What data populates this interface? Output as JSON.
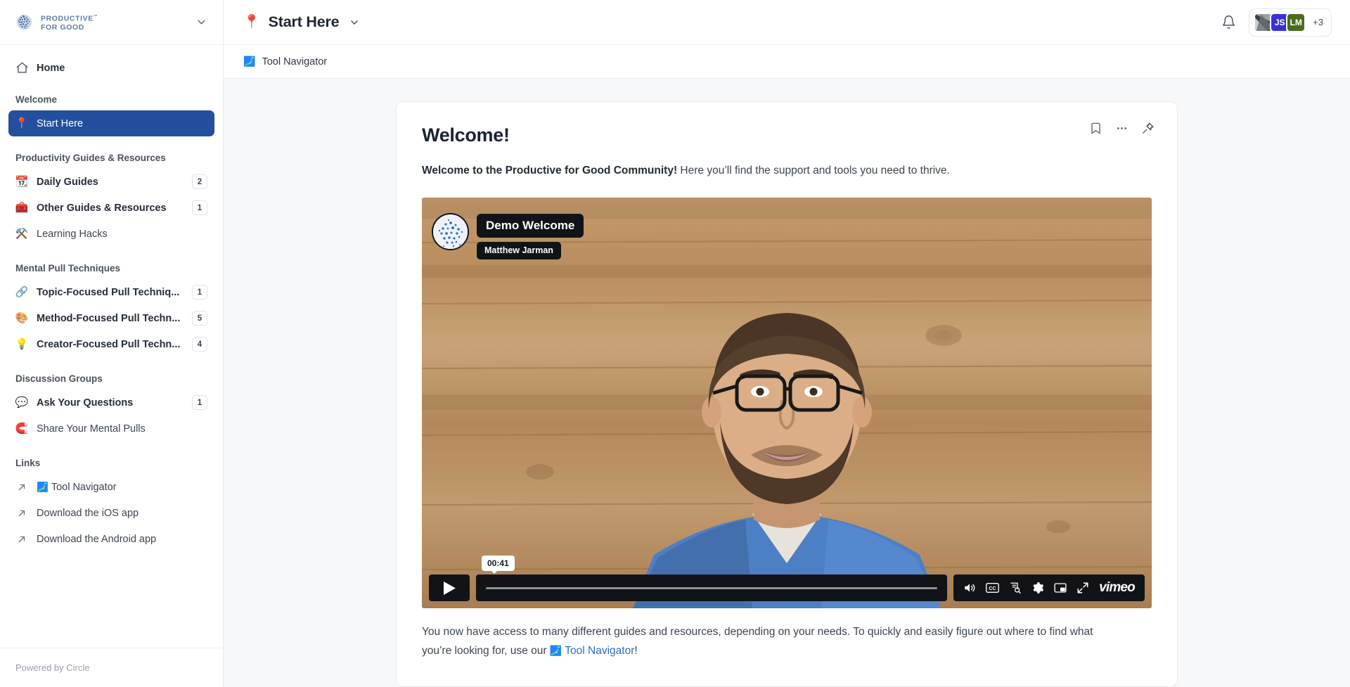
{
  "brand": {
    "logo_line1": "PRODUCTIVE",
    "logo_line2": "FOR GOOD",
    "trademark": "™",
    "accent_blue": "#23509e",
    "link_blue": "#2c6ecb"
  },
  "sidebar": {
    "home": {
      "label": "Home",
      "icon": "home-icon"
    },
    "sections": [
      {
        "title": "Welcome",
        "items": [
          {
            "label": "Start Here",
            "emoji": "📍",
            "badge": null,
            "active": true
          }
        ]
      },
      {
        "title": "Productivity Guides & Resources",
        "items": [
          {
            "label": "Daily Guides",
            "emoji": "📆",
            "badge": "2",
            "active": false
          },
          {
            "label": "Other Guides & Resources",
            "emoji": "🧰",
            "badge": "1",
            "active": false
          },
          {
            "label": "Learning Hacks",
            "emoji": "⚒️",
            "badge": null,
            "active": false
          }
        ]
      },
      {
        "title": "Mental Pull Techniques",
        "items": [
          {
            "label": "Topic-Focused Pull Techniq...",
            "emoji": "🔗",
            "badge": "1",
            "active": false
          },
          {
            "label": "Method-Focused Pull Techn...",
            "emoji": "🎨",
            "badge": "5",
            "active": false
          },
          {
            "label": "Creator-Focused Pull Techn...",
            "emoji": "💡",
            "badge": "4",
            "active": false
          }
        ]
      },
      {
        "title": "Discussion Groups",
        "items": [
          {
            "label": "Ask Your Questions",
            "emoji": "💬",
            "badge": "1",
            "active": false
          },
          {
            "label": "Share Your Mental Pulls",
            "emoji": "🧲",
            "badge": null,
            "active": false
          }
        ]
      }
    ],
    "links_title": "Links",
    "links": [
      {
        "label": "Tool Navigator",
        "emoji": "🗾",
        "icon": "external-link-arrow-icon"
      },
      {
        "label": "Download the iOS app",
        "emoji": "",
        "icon": "external-link-arrow-icon"
      },
      {
        "label": "Download the Android app",
        "emoji": "",
        "icon": "external-link-arrow-icon"
      }
    ],
    "footer": "Powered by Circle"
  },
  "topbar": {
    "space_emoji": "📍",
    "space_title": "Start Here",
    "caret_icon": "chevron-down-icon",
    "bell_icon": "notification-bell-icon",
    "members": {
      "avatars": [
        {
          "type": "photo",
          "initials": "",
          "color": "#9aa0a6"
        },
        {
          "type": "initials",
          "initials": "JS",
          "color": "#3b30d6"
        },
        {
          "type": "initials",
          "initials": "LM",
          "color": "#4b6b20"
        }
      ],
      "overflow": "+3"
    }
  },
  "subbar": {
    "item_emoji": "🗾",
    "item_label": "Tool Navigator"
  },
  "card": {
    "title": "Welcome!",
    "actions": [
      {
        "name": "bookmark-icon",
        "label": "Bookmark"
      },
      {
        "name": "more-options-icon",
        "label": "More options"
      },
      {
        "name": "pin-icon",
        "label": "Pin"
      }
    ],
    "lead_bold": "Welcome to the Productive for Good Community!",
    "lead_rest": " Here you’ll find the support and tools you need to thrive.",
    "video": {
      "title": "Demo Welcome",
      "author": "Matthew Jarman",
      "duration": "00:41",
      "provider": "vimeo",
      "controls": [
        "play-button",
        "volume-icon",
        "closed-captions-icon",
        "transcript-icon",
        "settings-gear-icon",
        "picture-in-picture-icon",
        "fullscreen-icon"
      ]
    },
    "body_p1": "You now have access to many different guides and resources, depending on your needs. To quickly and easily figure out where to find what you’re looking for, use our ",
    "body_emoji": "🗾",
    "body_link": "Tool Navigator",
    "body_p2": "!"
  }
}
